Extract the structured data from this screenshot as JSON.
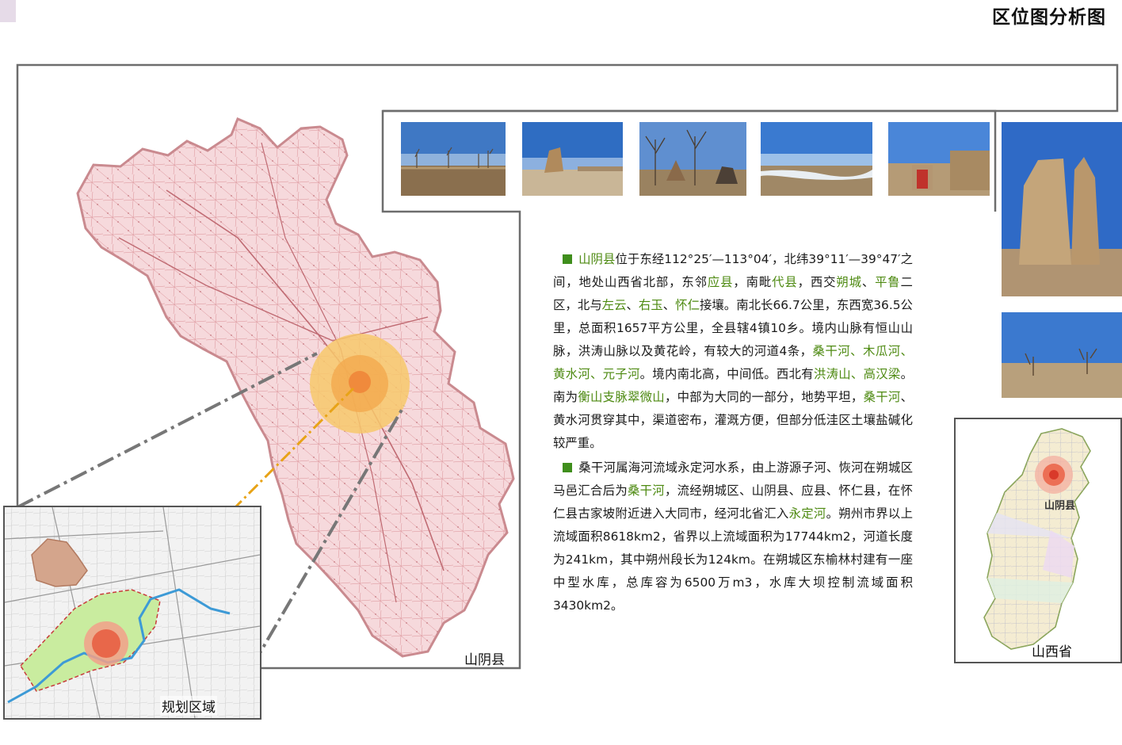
{
  "title": "区位图分析图",
  "labels": {
    "county_map": "山阴县",
    "planning_area": "规划区域",
    "province_map": "山西省",
    "province_county": "山阴县"
  },
  "colors": {
    "county_fill": "#f6d9dc",
    "county_border": "#c98a8f",
    "highlight_outer": "#f7c86b",
    "highlight_core": "#f08a3c",
    "leader_line": "#e8a317",
    "bullet": "#3f8e1c",
    "place_name_green": "#4e8a12"
  },
  "photos": [
    {
      "name": "photo-field-trees"
    },
    {
      "name": "photo-earthen-ruin"
    },
    {
      "name": "photo-ruins-bare-trees"
    },
    {
      "name": "photo-frozen-river"
    },
    {
      "name": "photo-village-gate"
    },
    {
      "name": "photo-tall-ruin"
    },
    {
      "name": "photo-dry-grass"
    }
  ],
  "description": {
    "p1": [
      {
        "t": "山阴县",
        "hl": true
      },
      {
        "t": "位于东经112°25′—113°04′，北纬39°11′—39°47′之间，地处山西省北部，东邻",
        "hl": false
      },
      {
        "t": "应县",
        "hl": true
      },
      {
        "t": "，南毗",
        "hl": false
      },
      {
        "t": "代县",
        "hl": true
      },
      {
        "t": "，西交",
        "hl": false
      },
      {
        "t": "朔城",
        "hl": true
      },
      {
        "t": "、",
        "hl": false
      },
      {
        "t": "平鲁",
        "hl": true
      },
      {
        "t": "二区，北与",
        "hl": false
      },
      {
        "t": "左云",
        "hl": true
      },
      {
        "t": "、",
        "hl": false
      },
      {
        "t": "右玉",
        "hl": true
      },
      {
        "t": "、",
        "hl": false
      },
      {
        "t": "怀仁",
        "hl": true
      },
      {
        "t": "接壤。南北长66.7公里，东西宽36.5公里，总面积1657平方公里，全县辖4镇10乡。境内山脉有恒山山脉，洪涛山脉以及黄花岭，有较大的河道4条，",
        "hl": false
      },
      {
        "t": "桑干河、木瓜河、黄水河、元子河",
        "hl": true
      },
      {
        "t": "。境内南北高，中间低。西北有",
        "hl": false
      },
      {
        "t": "洪涛山、高汉梁",
        "hl": true
      },
      {
        "t": "。南为",
        "hl": false
      },
      {
        "t": "衡山支脉翠微山",
        "hl": true
      },
      {
        "t": "，中部为大同的一部分，地势平坦，",
        "hl": false
      },
      {
        "t": "桑干河",
        "hl": true
      },
      {
        "t": "、黄水河贯穿其中，渠道密布，灌溉方便，但部分低洼区土壤盐碱化较严重。",
        "hl": false
      }
    ],
    "p2": [
      {
        "t": "桑干河属海河流域永定河水系，由上游源子河、恢河在朔城区马邑汇合后为",
        "hl": false
      },
      {
        "t": "桑干河",
        "hl": true
      },
      {
        "t": "，流经朔城区、山阴县、应县、怀仁县，在怀仁县古家坡附近进入大同市，经河北省汇入",
        "hl": false
      },
      {
        "t": "永定河",
        "hl": true
      },
      {
        "t": "。朔州市界以上流域面积8618km2，省界以上流域面积为17744km2，河道长度为241km，其中朔州段长为124km。在朔城区东榆林村建有一座中型水库，总库容为6500万m3，水库大坝控制流域面积3430km2。",
        "hl": false
      }
    ]
  }
}
